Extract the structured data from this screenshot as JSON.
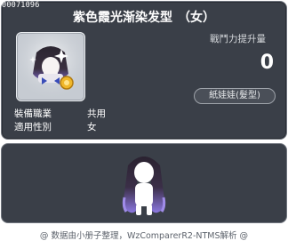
{
  "item": {
    "id": "00071096",
    "title": "紫色霞光渐染发型",
    "gender_tag": "（女）"
  },
  "stat": {
    "label": "戰鬥力提升量",
    "value": "0"
  },
  "category_badge": "紙娃娃(髮型)",
  "properties": [
    {
      "key": "裝備職業",
      "value": "共用"
    },
    {
      "key": "適用性別",
      "value": "女"
    }
  ],
  "footer": {
    "text": "@ 数据由小册子整理，WzComparerR2-NTMS解析 @"
  },
  "colors": {
    "panel_bg": "#3a3f48",
    "panel_border": "#6f747d",
    "text_primary": "#ffffff",
    "text_secondary": "#d5d8dc"
  }
}
